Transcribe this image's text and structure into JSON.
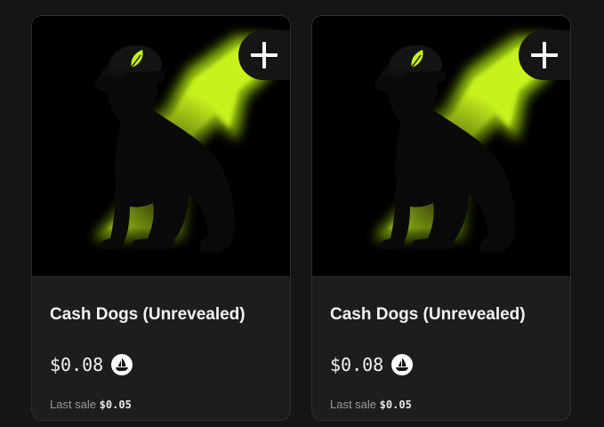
{
  "cards": [
    {
      "name": "Cash Dogs (Unrevealed)",
      "price": "$0.08",
      "last_sale_label": "Last sale",
      "last_sale_value": "$0.05",
      "add_icon": "plus-icon",
      "currency_icon": "opensea-icon"
    },
    {
      "name": "Cash Dogs (Unrevealed)",
      "price": "$0.08",
      "last_sale_label": "Last sale",
      "last_sale_value": "$0.05",
      "add_icon": "plus-icon",
      "currency_icon": "opensea-icon"
    }
  ],
  "colors": {
    "background": "#151515",
    "card": "#1d1d1d",
    "accent_glow": "#c8f21a",
    "text_primary": "#f2f2f2",
    "text_secondary": "#9a9a9a"
  }
}
